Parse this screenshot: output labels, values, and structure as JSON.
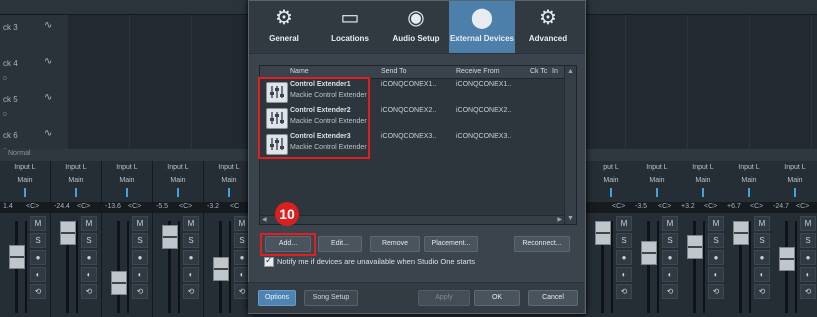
{
  "arrange": {
    "tracks": [
      {
        "name": "ck 3",
        "sub": ""
      },
      {
        "name": "ck 4",
        "sub": "o"
      },
      {
        "name": "ck 5",
        "sub": "o"
      },
      {
        "name": "ck 6",
        "sub": "o"
      }
    ],
    "wave_glyph": "∿",
    "mode_label": "Normal"
  },
  "mixer": {
    "left_strips": [
      {
        "in": "Input L",
        "out": "Main",
        "pan": "1.4",
        "center": "<C>"
      },
      {
        "in": "Input L",
        "out": "Main",
        "pan": "-24.4",
        "center": "<C>"
      },
      {
        "in": "Input L",
        "out": "Main",
        "pan": "-13.6",
        "center": "<C>"
      },
      {
        "in": "Input L",
        "out": "Main",
        "pan": "-5.5",
        "center": "<C>"
      },
      {
        "in": "Input L",
        "out": "Main",
        "pan": "-3.2",
        "center": "<C"
      }
    ],
    "right_strips": [
      {
        "in": "put L",
        "out": "Main",
        "pan": "",
        "center": "<C>"
      },
      {
        "in": "Input L",
        "out": "Main",
        "pan": "-3.5",
        "center": "<C>"
      },
      {
        "in": "Input L",
        "out": "Main",
        "pan": "+3.2",
        "center": "<C>"
      },
      {
        "in": "Input L",
        "out": "Main",
        "pan": "+6.7",
        "center": "<C>"
      },
      {
        "in": "Input L",
        "out": "Main",
        "pan": "-24.7",
        "center": "<C>"
      }
    ],
    "mute_label": "M",
    "solo_label": "S"
  },
  "dialog": {
    "tabs": [
      {
        "label": "General",
        "icon": "gear-outline-icon",
        "glyph": "⚙"
      },
      {
        "label": "Locations",
        "icon": "drive-icon",
        "glyph": "▭"
      },
      {
        "label": "Audio Setup",
        "icon": "speaker-icon",
        "glyph": "◉"
      },
      {
        "label": "External Devices",
        "icon": "midi-port-icon",
        "glyph": "⬤"
      },
      {
        "label": "Advanced",
        "icon": "gears-icon",
        "glyph": "⚙"
      }
    ],
    "active_tab": "External Devices",
    "columns": [
      "Name",
      "Send To",
      "Receive From",
      "Ck Tc",
      "In"
    ],
    "devices": [
      {
        "name": "Control Extender1",
        "model": "Mackie Control Extender",
        "send_to": "iCONQCONEX1..",
        "receive_from": "iCONQCONEX1.."
      },
      {
        "name": "Control Extender2",
        "model": "Mackie Control Extender",
        "send_to": "iCONQCONEX2..",
        "receive_from": "iCONQCONEX2.."
      },
      {
        "name": "Control Extender3",
        "model": "Mackie Control Extender",
        "send_to": "iCONQCONEX3..",
        "receive_from": "iCONQCONEX3.."
      }
    ],
    "step_number": "10",
    "buttons": {
      "add": "Add...",
      "edit": "Edit...",
      "remove": "Remove",
      "placement": "Placement...",
      "reconnect": "Reconnect..."
    },
    "notify_label": "Notify me if devices are unavailable when Studio One starts",
    "notify_checked": true,
    "footer": {
      "options": "Options",
      "song_setup": "Song Setup",
      "apply": "Apply",
      "ok": "OK",
      "cancel": "Cancel"
    }
  },
  "colors": {
    "accent_tab": "#4c80aa",
    "highlight_red": "#e0201f",
    "options_button": "#4d84b4"
  }
}
